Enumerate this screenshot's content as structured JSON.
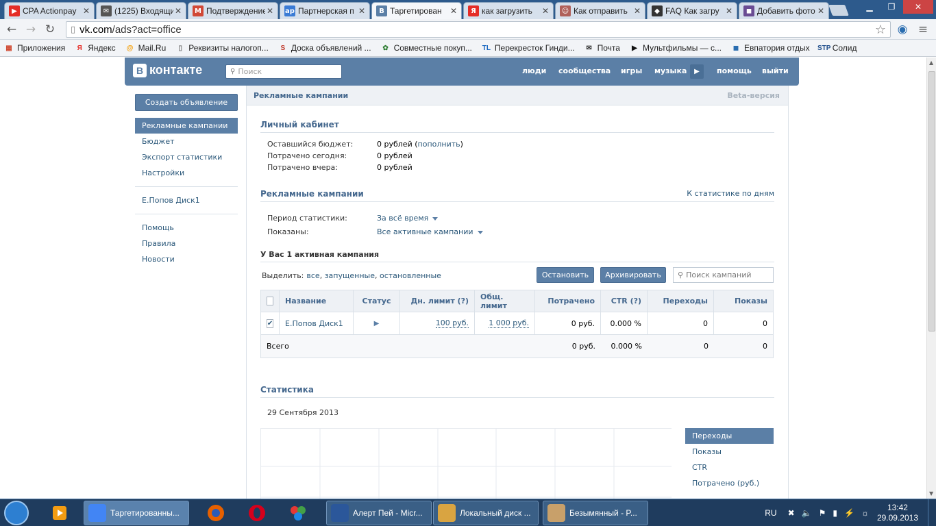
{
  "browser": {
    "tabs": [
      {
        "title": "CPA Actionpay",
        "icon": "youtube-icon",
        "color": "#e52d27",
        "glyph": "▶"
      },
      {
        "title": "(1225) Входящие",
        "icon": "mail-icon",
        "color": "#555555",
        "glyph": "✉"
      },
      {
        "title": "Подтверждение",
        "icon": "gmail-icon",
        "color": "#d14836",
        "glyph": "M"
      },
      {
        "title": "Партнерская п",
        "icon": "ap-icon",
        "color": "#3a7bd5",
        "glyph": "ap"
      },
      {
        "title": "Таргетирован",
        "icon": "vk-icon",
        "color": "#5b7fa6",
        "glyph": "B"
      },
      {
        "title": "как загрузить",
        "icon": "yandex-icon",
        "color": "#e52d27",
        "glyph": "Я"
      },
      {
        "title": "Как отправить",
        "icon": "avatar-icon",
        "color": "#b0605a",
        "glyph": "☺"
      },
      {
        "title": "FAQ Как загру",
        "icon": "shield-icon",
        "color": "#333333",
        "glyph": "◆"
      },
      {
        "title": "Добавить фото",
        "icon": "photo-icon",
        "color": "#6a4c93",
        "glyph": "◼"
      }
    ],
    "url_host": "vk.com",
    "url_path": "/ads?act=office",
    "bookmarks": [
      {
        "label": "Приложения",
        "icon": "apps-icon",
        "color": "#d04a32",
        "glyph": "▦"
      },
      {
        "label": "Яндекс",
        "icon": "yandex-icon",
        "color": "#e52d27",
        "glyph": "Я"
      },
      {
        "label": "Mail.Ru",
        "icon": "mailru-icon",
        "color": "#f59c00",
        "glyph": "@"
      },
      {
        "label": "Реквизиты налогоп...",
        "icon": "page-icon",
        "color": "#777777",
        "glyph": "▯"
      },
      {
        "label": "Доска объявлений ...",
        "icon": "board-icon",
        "color": "#c0392b",
        "glyph": "S"
      },
      {
        "label": "Совместные покуп...",
        "icon": "sp-icon",
        "color": "#2e7d32",
        "glyph": "✿"
      },
      {
        "label": "Перекресток Гинди...",
        "icon": "tl-icon",
        "color": "#1565c0",
        "glyph": "TL"
      },
      {
        "label": "Почта",
        "icon": "mail-icon",
        "color": "#333333",
        "glyph": "✉"
      },
      {
        "label": "Мультфильмы — с...",
        "icon": "play-icon",
        "color": "#111111",
        "glyph": "▶"
      },
      {
        "label": "Евпатория отдых",
        "icon": "photo-icon",
        "color": "#2a6db0",
        "glyph": "◼"
      },
      {
        "label": "Солид",
        "icon": "stp-icon",
        "color": "#1f4e8c",
        "glyph": "STP"
      }
    ]
  },
  "vk": {
    "logo": "контакте",
    "logo_letter": "В",
    "search_placeholder": "Поиск",
    "nav": [
      "люди",
      "сообщества",
      "игры",
      "музыка",
      "помощь",
      "выйти"
    ],
    "sidebar": {
      "create_button": "Создать объявление",
      "group1": [
        "Рекламные кампании",
        "Бюджет",
        "Экспорт статистики",
        "Настройки"
      ],
      "group2": [
        "Е.Попов Диск1"
      ],
      "group3": [
        "Помощь",
        "Правила",
        "Новости"
      ]
    },
    "content": {
      "header_title": "Рекламные кампании",
      "beta": "Beta-версия",
      "cabinet": {
        "title": "Личный кабинет",
        "rows": [
          {
            "k": "Оставшийся бюджет:",
            "v": "0 рублей",
            "link": "пополнить"
          },
          {
            "k": "Потрачено сегодня:",
            "v": "0 рублей"
          },
          {
            "k": "Потрачено вчера:",
            "v": "0 рублей"
          }
        ]
      },
      "campaigns": {
        "title": "Рекламные кампании",
        "stats_link": "К статистике по дням",
        "period_label": "Период статистики:",
        "period_value": "За всё время",
        "shown_label": "Показаны:",
        "shown_value": "Все активные кампании",
        "active_count": "У Вас 1 активная кампания",
        "select_label": "Выделить:",
        "select_all": "все",
        "select_running": "запущенные",
        "select_stopped": "остановленные",
        "stop_button": "Остановить",
        "archive_button": "Архивировать",
        "search_placeholder": "Поиск кампаний",
        "table": {
          "headers": [
            "Название",
            "Статус",
            "Дн. лимит (?)",
            "Общ. лимит",
            "Потрачено",
            "CTR (?)",
            "Переходы",
            "Показы"
          ],
          "row": {
            "name": "Е.Попов Диск1",
            "day_limit": "100 руб.",
            "total_limit": "1 000 руб.",
            "spent": "0 руб.",
            "ctr": "0.000 %",
            "clicks": "0",
            "views": "0"
          },
          "total": {
            "label": "Всего",
            "spent": "0 руб.",
            "ctr": "0.000 %",
            "clicks": "0",
            "views": "0"
          }
        }
      },
      "stats": {
        "title": "Статистика",
        "date": "29 Сентября 2013",
        "legend": [
          "Переходы",
          "Показы",
          "CTR",
          "Потрачено (руб.)"
        ]
      }
    }
  },
  "taskbar": {
    "tasks": [
      {
        "label": "Таргетированны...",
        "color": "#4285f4"
      },
      {
        "label": "Алерт Пей - Micr...",
        "color": "#2b579a"
      },
      {
        "label": "Локальный диск ...",
        "color": "#d9a441"
      },
      {
        "label": "Безымянный - P...",
        "color": "#c8a06a"
      }
    ],
    "lang": "RU",
    "time": "13:42",
    "date": "29.09.2013"
  }
}
